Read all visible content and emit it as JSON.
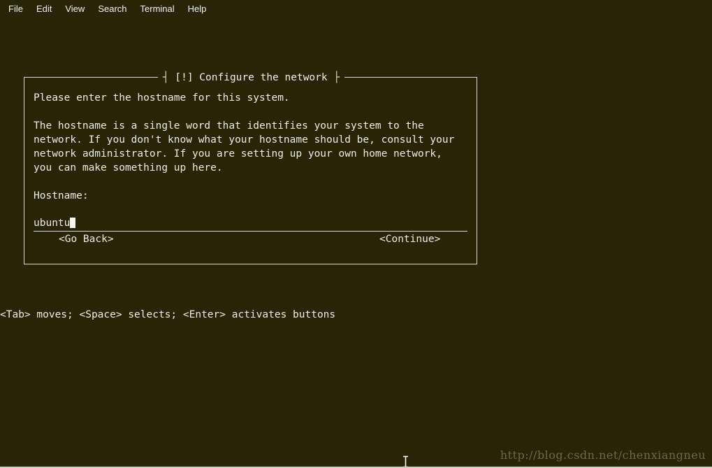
{
  "window": {
    "background_color": "#282405",
    "foreground_color": "#eeeee6",
    "border_color": "#d8d8d0"
  },
  "menubar": {
    "items": [
      {
        "label": "File"
      },
      {
        "label": "Edit"
      },
      {
        "label": "View"
      },
      {
        "label": "Search"
      },
      {
        "label": "Terminal"
      },
      {
        "label": "Help"
      }
    ]
  },
  "dialog": {
    "title": "[!] Configure the network",
    "title_left_bracket": "┤",
    "title_right_bracket": "├",
    "prompt": "Please enter the hostname for this system.",
    "description_lines": [
      "The hostname is a single word that identifies your system to the",
      "network. If you don't know what your hostname should be, consult your",
      "network administrator. If you are setting up your own home network,",
      "you can make something up here."
    ],
    "field_label": "Hostname:",
    "field_value": "ubuntu",
    "field_placeholder": "",
    "cursor": "block-cursor",
    "buttons": {
      "back_label": "<Go Back>",
      "continue_label": "<Continue>"
    }
  },
  "footer": {
    "hint": "<Tab> moves; <Space> selects; <Enter> activates buttons"
  },
  "watermark": {
    "text": "http://blog.csdn.net/chenxiangneu"
  }
}
